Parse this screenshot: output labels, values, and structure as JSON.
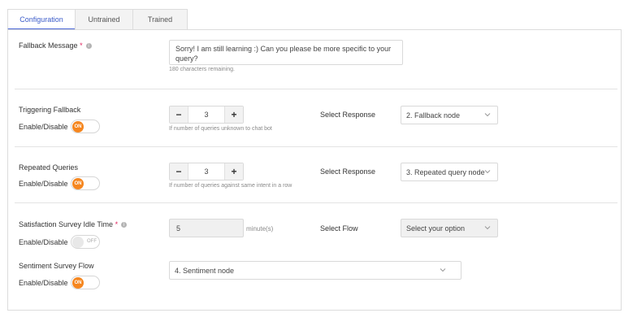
{
  "tabs": [
    {
      "label": "Configuration",
      "active": true
    },
    {
      "label": "Untrained",
      "active": false
    },
    {
      "label": "Trained",
      "active": false
    }
  ],
  "fallback": {
    "label": "Fallback Message",
    "required_mark": "*",
    "message": "Sorry! I am still learning :) Can you please be more specific to your query?",
    "chars_remaining": "180 characters remaining."
  },
  "triggering": {
    "label": "Triggering Fallback",
    "enable_label": "Enable/Disable",
    "toggle": "ON",
    "count": "3",
    "hint": "If number of queries unknown to chat bot",
    "response_label": "Select Response",
    "response_value": "2. Fallback node"
  },
  "repeated": {
    "label": "Repeated Queries",
    "enable_label": "Enable/Disable",
    "toggle": "ON",
    "count": "3",
    "hint": "If number of queries against same intent in a row",
    "response_label": "Select Response",
    "response_value": "3. Repeated query node"
  },
  "satisfaction": {
    "label": "Satisfaction Survey Idle Time",
    "required_mark": "*",
    "enable_label": "Enable/Disable",
    "toggle": "OFF",
    "time_value": "5",
    "unit": "minute(s)",
    "flow_label": "Select Flow",
    "flow_placeholder": "Select your option"
  },
  "sentiment": {
    "label": "Sentiment Survey Flow",
    "enable_label": "Enable/Disable",
    "toggle": "ON",
    "flow_value": "4. Sentiment node"
  },
  "stepper": {
    "minus": "−",
    "plus": "+"
  },
  "icons": {
    "info": "info-icon",
    "chevron": "chevron-down-icon"
  },
  "colors": {
    "accent": "#f5861f",
    "tab_active": "#3b5bc9"
  }
}
